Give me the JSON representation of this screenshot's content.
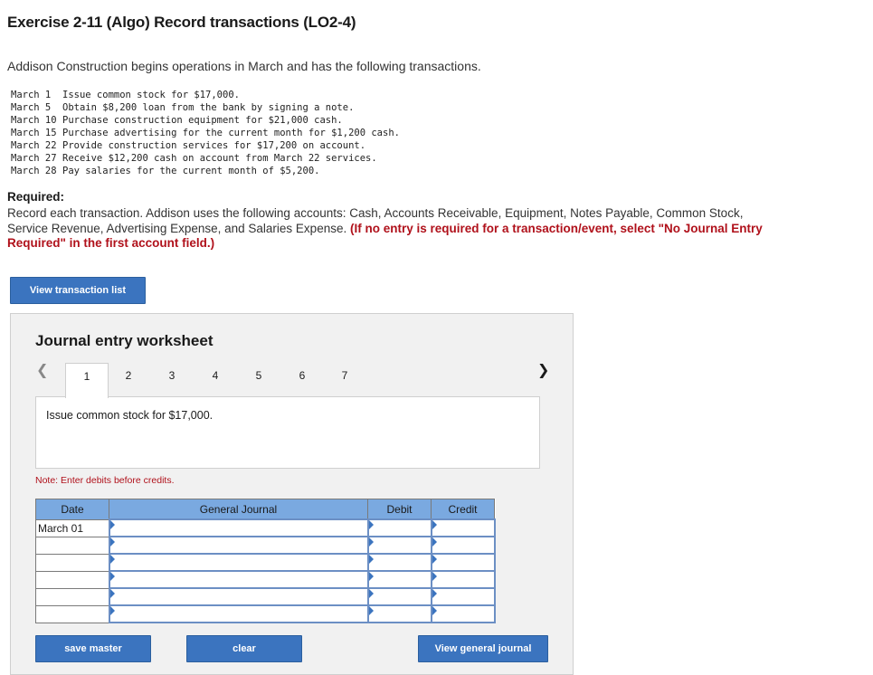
{
  "header": {
    "title": "Exercise 2-11 (Algo) Record transactions (LO2-4)"
  },
  "intro": "Addison Construction begins operations in March and has the following transactions.",
  "transactions": [
    {
      "date": "March 1",
      "text": "Issue common stock for $17,000."
    },
    {
      "date": "March 5",
      "text": "Obtain $8,200 loan from the bank by signing a note."
    },
    {
      "date": "March 10",
      "text": "Purchase construction equipment for $21,000 cash."
    },
    {
      "date": "March 15",
      "text": "Purchase advertising for the current month for $1,200 cash."
    },
    {
      "date": "March 22",
      "text": "Provide construction services for $17,200 on account."
    },
    {
      "date": "March 27",
      "text": "Receive $12,200 cash on account from March 22 services."
    },
    {
      "date": "March 28",
      "text": "Pay salaries for the current month of $5,200."
    }
  ],
  "required": {
    "heading": "Required:",
    "body": "Record each transaction. Addison uses the following accounts: Cash, Accounts Receivable, Equipment, Notes Payable, Common Stock, Service Revenue, Advertising Expense, and Salaries Expense. ",
    "note": "(If no entry is required for a transaction/event, select \"No Journal Entry Required\" in the first account field.)"
  },
  "buttons": {
    "view_transaction_list": "View transaction list",
    "save_master": "save master",
    "clear": "clear",
    "view_general_journal": "View general journal"
  },
  "worksheet": {
    "title": "Journal entry worksheet",
    "prev_icon": "chevron-left-icon",
    "next_icon": "chevron-right-icon",
    "tabs": [
      "1",
      "2",
      "3",
      "4",
      "5",
      "6",
      "7"
    ],
    "active_tab": "1",
    "description": "Issue common stock for $17,000.",
    "note": "Note: Enter debits before credits.",
    "table": {
      "headers": {
        "date": "Date",
        "general_journal": "General Journal",
        "debit": "Debit",
        "credit": "Credit"
      },
      "rows": [
        {
          "date": "March 01"
        },
        {
          "date": ""
        },
        {
          "date": ""
        },
        {
          "date": ""
        },
        {
          "date": ""
        },
        {
          "date": ""
        }
      ]
    }
  },
  "colors": {
    "accent": "#3b74bf",
    "header_fill": "#7aa9e0",
    "warning_red": "#b0111b"
  }
}
